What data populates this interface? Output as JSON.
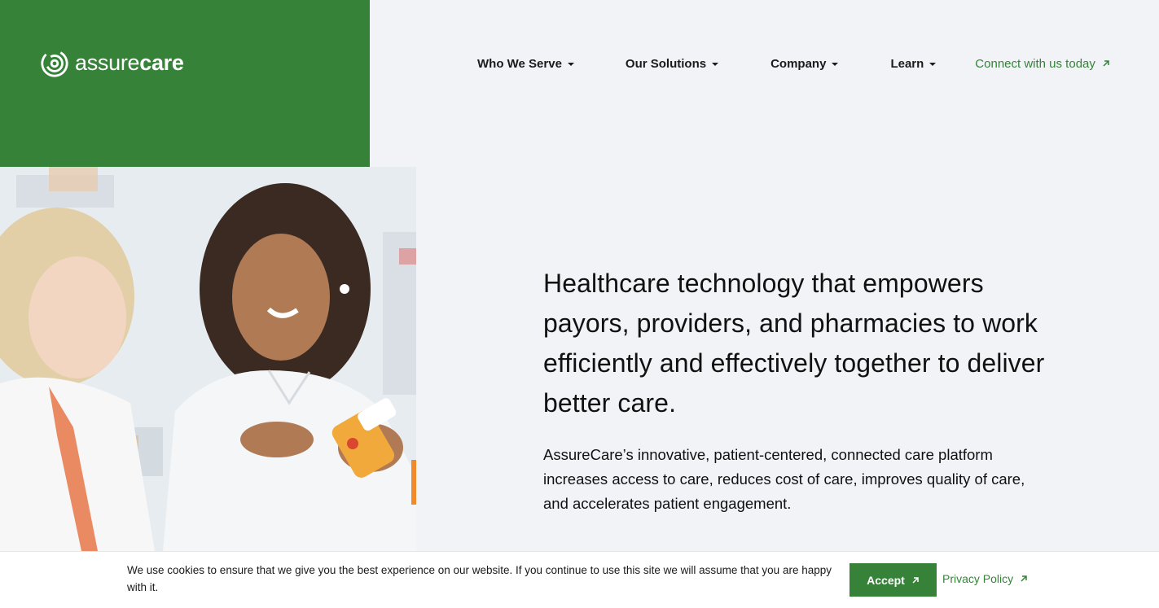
{
  "brand": {
    "logo_text_light": "assure",
    "logo_text_bold": "care",
    "color": "#358238"
  },
  "nav": {
    "items": [
      {
        "label": "Who We Serve"
      },
      {
        "label": "Our Solutions"
      },
      {
        "label": "Company"
      },
      {
        "label": "Learn"
      }
    ],
    "cta_label": "Connect with us today"
  },
  "hero": {
    "headline": "Healthcare technology that empowers payors, providers, and pharmacies to work efficiently and effectively together to deliver better care.",
    "subtext": "AssureCare’s innovative, patient-centered, connected care platform increases access to care, reduces cost of care, improves quality of care, and accelerates patient engagement."
  },
  "cookie": {
    "message": "We use cookies to ensure that we give you the best experience on our website. If you continue to use this site we will assume that you are happy with it.",
    "accept_label": "Accept",
    "privacy_label": "Privacy Policy"
  }
}
